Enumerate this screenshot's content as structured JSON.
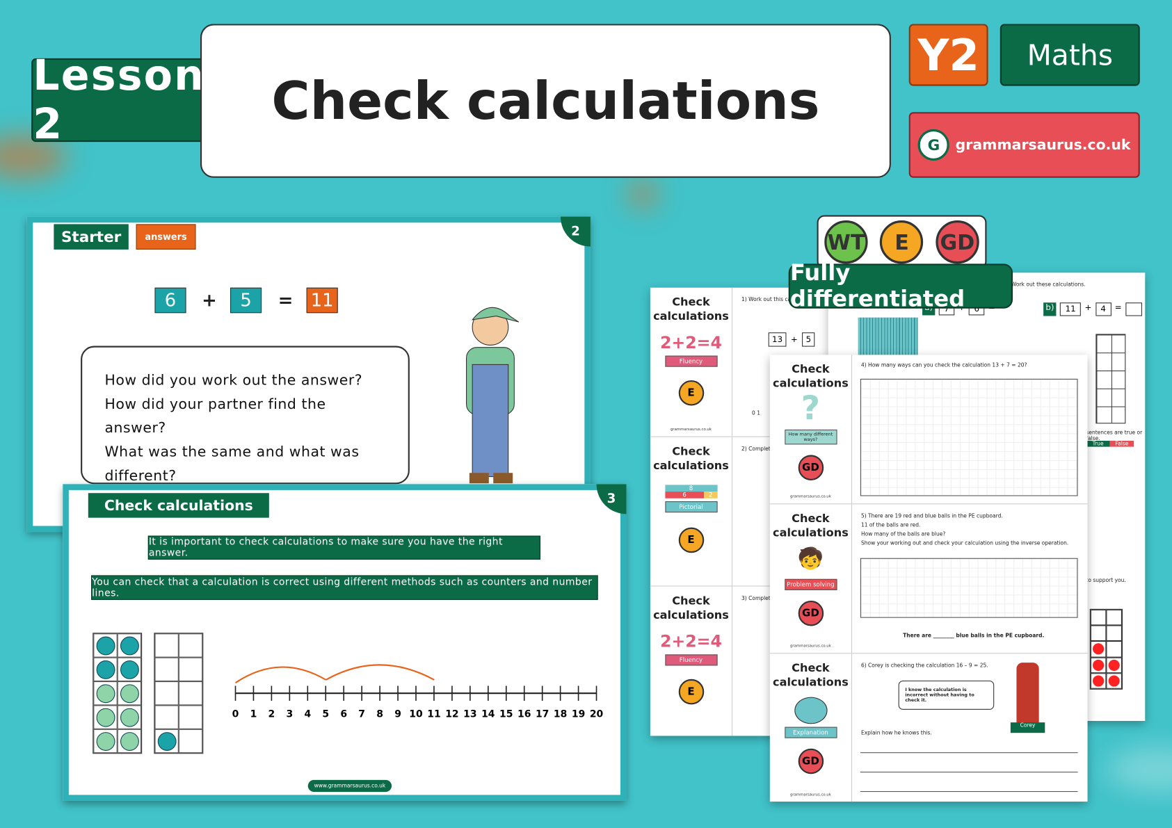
{
  "header": {
    "lesson": "Lesson 2",
    "title": "Check calculations",
    "year": "Y2",
    "subject": "Maths",
    "brand": "grammarsaurus.co.uk"
  },
  "colors": {
    "background": "#41c3c9",
    "green": "#0b6b47",
    "orange": "#e8641a",
    "red": "#e84e55",
    "teal": "#1ba3a8"
  },
  "slide2": {
    "number": "2",
    "tab": "Starter",
    "answers": "answers",
    "equation": {
      "a": "6",
      "op": "+",
      "b": "5",
      "eq": "=",
      "result": "11"
    },
    "bubble": [
      "How did you work out the answer?",
      "How did your partner find the answer?",
      "What was the same and what was different?"
    ]
  },
  "slide3": {
    "number": "3",
    "tab": "Check calculations",
    "banner1": "It is important to check calculations to make sure you have the right answer.",
    "banner2": "You can check that a calculation is correct using different methods such as counters and number lines.",
    "numberline": [
      "0",
      "1",
      "2",
      "3",
      "4",
      "5",
      "6",
      "7",
      "8",
      "9",
      "10",
      "11",
      "12",
      "13",
      "14",
      "15",
      "16",
      "17",
      "18",
      "19",
      "20"
    ],
    "footer": "www.grammarsaurus.co.uk"
  },
  "differentiation": {
    "badges": [
      "WT",
      "E",
      "GD"
    ],
    "banner": "Fully differentiated"
  },
  "worksheets": {
    "back": {
      "rows": [
        {
          "title": "Check calculations",
          "type": "2+2=4",
          "label": "Fluency",
          "badge": "E",
          "q": "1) Work out this calculation",
          "eq": [
            "13",
            "+",
            "5"
          ],
          "nl": [
            "0",
            "1"
          ]
        },
        {
          "title": "Check calculations",
          "bar": [
            "8",
            "6",
            "2"
          ],
          "label": "Pictorial",
          "badge": "E",
          "q": "2) Complete"
        },
        {
          "title": "Check calculations",
          "type": "2+2=4",
          "label": "Fluency",
          "badge": "E",
          "q": "3) Complete"
        }
      ],
      "footer": "grammarsaurus.co.uk"
    },
    "right": {
      "q1": "Work out these calculations.",
      "a": [
        "a)",
        "7",
        "+",
        "6",
        "="
      ],
      "b": [
        "b)",
        "11",
        "+",
        "4",
        "="
      ],
      "q2": "sentences are true or false.",
      "true": "True",
      "false": "False",
      "q3": "to support you."
    },
    "front": {
      "rows": [
        {
          "title": "Check calculations",
          "label": "How many different ways?",
          "badge": "GD",
          "q": "4) How many ways can you check the calculation 13 + 7 = 20?"
        },
        {
          "title": "Check calculations",
          "label": "Problem solving",
          "badge": "GD",
          "q": [
            "5) There are 19 red and blue balls in the PE cupboard.",
            "11 of the balls are red.",
            "How many of the balls are blue?",
            "Show your working out and check your calculation using the inverse operation."
          ],
          "answer": "There are ________ blue balls in the PE cupboard."
        },
        {
          "title": "Check calculations",
          "label": "Explanation",
          "badge": "GD",
          "q": "6) Corey is checking the calculation 16 – 9 = 25.",
          "speech": "I know the calculation is incorrect without having to check it.",
          "name": "Corey",
          "explain": "Explain how he knows this."
        }
      ],
      "footer": "grammarsaurus.co.uk"
    }
  }
}
